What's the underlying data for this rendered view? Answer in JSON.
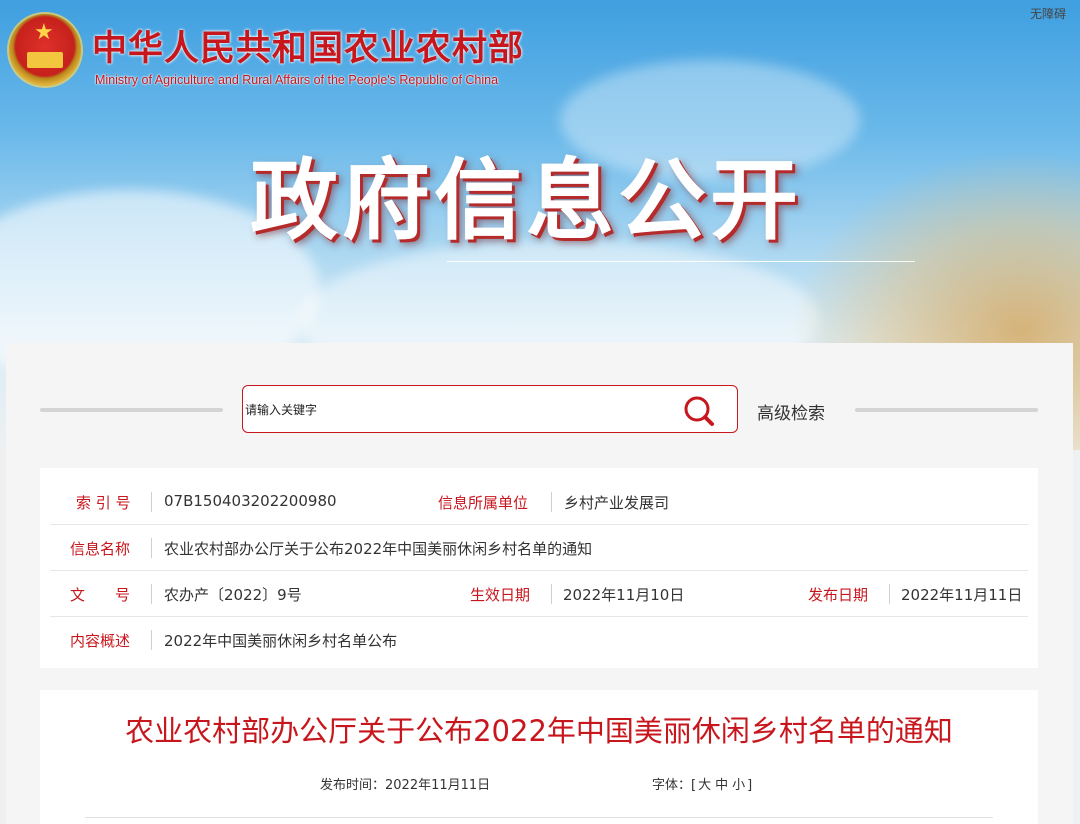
{
  "header": {
    "ministry_name_cn": "中华人民共和国农业农村部",
    "ministry_name_en": "Ministry of Agriculture and Rural Affairs of the People's Republic of China",
    "accessibility_link": "无障碍",
    "banner_title": "政府信息公开",
    "emblem_icon": "national-emblem-icon"
  },
  "search": {
    "placeholder": "请输入关键字",
    "advanced_label": "高级检索",
    "icon": "search-icon",
    "accent_color": "#c8161d"
  },
  "meta": {
    "index_label": "索 引 号",
    "index_value": "07B150403202200980",
    "unit_label": "信息所属单位",
    "unit_value": "乡村产业发展司",
    "name_label": "信息名称",
    "name_value": "农业农村部办公厅关于公布2022年中国美丽休闲乡村名单的通知",
    "doc_label": "文　　号",
    "doc_value": "农办产〔2022〕9号",
    "effective_label": "生效日期",
    "effective_value": "2022年11月10日",
    "publish_label": "发布日期",
    "publish_value": "2022年11月11日",
    "summary_label": "内容概述",
    "summary_value": "2022年中国美丽休闲乡村名单公布"
  },
  "article": {
    "title": "农业农村部办公厅关于公布2022年中国美丽休闲乡村名单的通知",
    "publish_time": "发布时间：2022年11月11日",
    "font_size_label": "字体：",
    "font_open": "[",
    "font_large": "大",
    "font_medium": "中",
    "font_small": "小",
    "font_close": "]"
  }
}
